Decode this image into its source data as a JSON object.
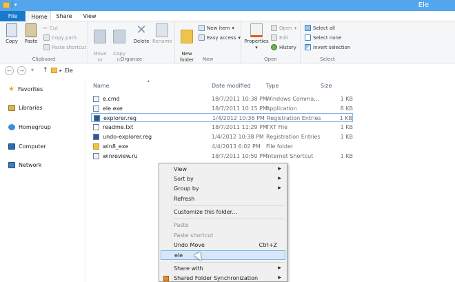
{
  "window": {
    "title": "Ele"
  },
  "tabs": {
    "file": "File",
    "home": "Home",
    "share": "Share",
    "view": "View"
  },
  "ribbon": {
    "clipboard": {
      "label": "Clipboard",
      "copy": "Copy",
      "paste": "Paste",
      "cut": "Cut",
      "copy_path": "Copy path",
      "paste_shortcut": "Paste shortcut"
    },
    "organize": {
      "label": "Organize",
      "move_to": "Move\nto",
      "copy_to": "Copy\nto",
      "delete": "Delete",
      "rename": "Rename"
    },
    "new": {
      "label": "New",
      "new_folder": "New\nfolder",
      "new_item": "New item",
      "easy_access": "Easy access"
    },
    "open": {
      "label": "Open",
      "properties": "Properties",
      "open": "Open",
      "edit": "Edit",
      "history": "History"
    },
    "select": {
      "label": "Select",
      "select_all": "Select all",
      "select_none": "Select none",
      "invert_selection": "Invert selection"
    }
  },
  "address": {
    "path": "Ele"
  },
  "nav": {
    "favorites": "Favorites",
    "libraries": "Libraries",
    "homegroup": "Homegroup",
    "computer": "Computer",
    "network": "Network"
  },
  "columns": {
    "name": "Name",
    "date": "Date modified",
    "type": "Type",
    "size": "Size"
  },
  "files": [
    {
      "name": "e.cmd",
      "date": "18/7/2011 10:38 PM",
      "type": "Windows Comma...",
      "size": "1 KB",
      "icon": "cmd-file-icon"
    },
    {
      "name": "ele.exe",
      "date": "18/7/2011 10:15 PM",
      "type": "Application",
      "size": "8 KB",
      "icon": "exe-file-icon"
    },
    {
      "name": "explorer.reg",
      "date": "1/4/2012 10:36 PM",
      "type": "Registration Entries",
      "size": "1 KB",
      "icon": "reg-file-icon"
    },
    {
      "name": "readme.txt",
      "date": "18/7/2011 11:29 PM",
      "type": "TXT File",
      "size": "1 KB",
      "icon": "txt-file-icon"
    },
    {
      "name": "undo-explorer.reg",
      "date": "1/4/2012 10:38 PM",
      "type": "Registration Entries",
      "size": "1 KB",
      "icon": "reg-file-icon"
    },
    {
      "name": "win8_exe",
      "date": "4/4/2013 6:02 PM",
      "type": "File folder",
      "size": "",
      "icon": "folder-icon"
    },
    {
      "name": "winreview.ru",
      "date": "18/7/2011 10:50 PM",
      "type": "Internet Shortcut",
      "size": "1 KB",
      "icon": "url-file-icon"
    }
  ],
  "context_menu": {
    "view": "View",
    "sort_by": "Sort by",
    "group_by": "Group by",
    "refresh": "Refresh",
    "customize": "Customize this folder...",
    "paste": "Paste",
    "paste_shortcut": "Paste shortcut",
    "undo_move": "Undo Move",
    "undo_shortcut": "Ctrl+Z",
    "ele": "ele",
    "share_with": "Share with",
    "shared_sync": "Shared Folder Synchronization"
  }
}
